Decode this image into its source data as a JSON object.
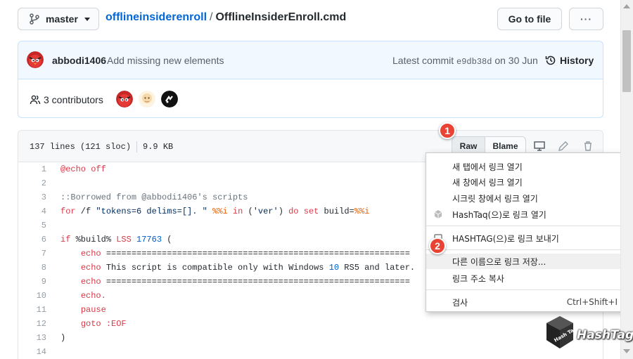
{
  "header": {
    "branch": "master",
    "repo": "offlineinsiderenroll",
    "separator": "/",
    "file": "OfflineInsiderEnroll.cmd",
    "goto_file": "Go to file",
    "more": "···"
  },
  "commit": {
    "user": "abbodi1406",
    "message": "Add missing new elements",
    "latest_label": "Latest commit",
    "sha": "e9db38d",
    "date": "on 30 Jun",
    "history": "History"
  },
  "contributors": {
    "label": "3 contributors"
  },
  "file": {
    "lines": "137 lines (121 sloc)",
    "size": "9.9 KB",
    "raw": "Raw",
    "blame": "Blame"
  },
  "code_lines": [
    {
      "n": "1",
      "text": "@echo off"
    },
    {
      "n": "2",
      "text": ""
    },
    {
      "n": "3",
      "text": "::Borrowed from @abbodi1406's scripts"
    },
    {
      "n": "4",
      "text": "for /f \"tokens=6 delims=[]. \" %%i in ('ver') do set build=%%i"
    },
    {
      "n": "5",
      "text": ""
    },
    {
      "n": "6",
      "text": "if %build% LSS 17763 ("
    },
    {
      "n": "7",
      "text": "    echo ============================================================"
    },
    {
      "n": "8",
      "text": "    echo This script is compatible only with Windows 10 RS5 and later."
    },
    {
      "n": "9",
      "text": "    echo ============================================================"
    },
    {
      "n": "10",
      "text": "    echo."
    },
    {
      "n": "11",
      "text": "    pause"
    },
    {
      "n": "12",
      "text": "    goto :EOF"
    },
    {
      "n": "13",
      "text": ")"
    },
    {
      "n": "14",
      "text": ""
    }
  ],
  "context_menu": {
    "items": [
      "새 탭에서 링크 열기",
      "새 창에서 링크 열기",
      "시크릿 창에서 링크 열기",
      "HashTaq(으)로 링크 열기",
      "HASHTAG(으)로 링크 보내기",
      "다른 이름으로 링크 저장...",
      "링크 주소 복사",
      "검사"
    ],
    "inspect_shortcut": "Ctrl+Shift+I"
  },
  "badges": {
    "one": "1",
    "two": "2"
  },
  "watermark": {
    "text": "HashTag",
    "cube_text": "Hash Tag"
  },
  "colors": {
    "link": "#0366d6",
    "commit_bg": "#f1f8ff",
    "badge": "#e84335",
    "keyword": "#d73a49"
  }
}
